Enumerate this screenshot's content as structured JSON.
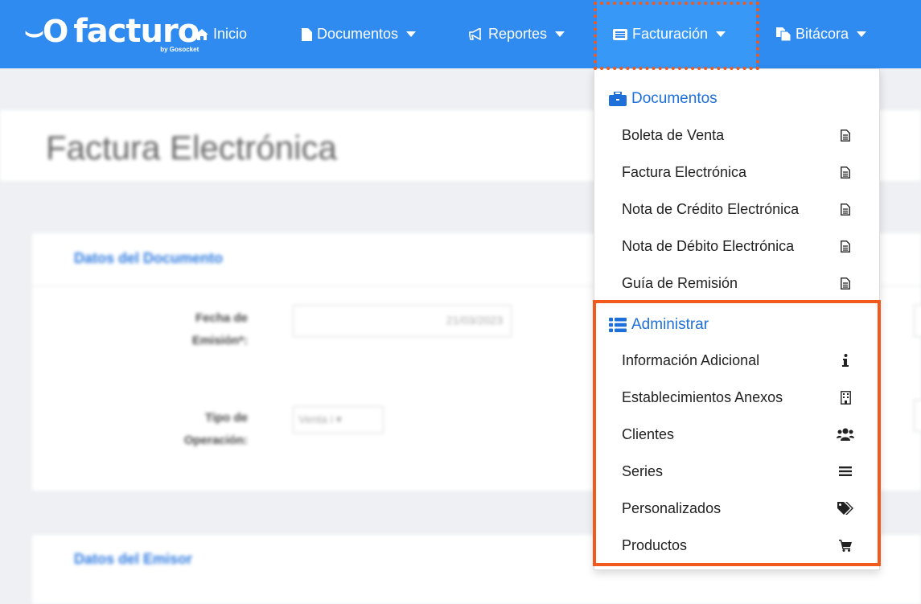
{
  "navbar": {
    "logo_text": "facturo",
    "logo_sub": "by Gosocket",
    "items": [
      {
        "label": "Inicio"
      },
      {
        "label": "Documentos"
      },
      {
        "label": "Reportes"
      },
      {
        "label": "Facturación"
      },
      {
        "label": "Bitácora"
      }
    ]
  },
  "page": {
    "title": "Factura Electrónica",
    "doc_section": {
      "title": "Datos del Documento",
      "fecha_label_1": "Fecha de",
      "fecha_label_2": "Emisión*:",
      "fecha_value": "21/03/2023",
      "tipo_label_1": "Tipo de",
      "tipo_label_2": "Operación:",
      "tipo_value": "Venta i"
    },
    "emisor_section": {
      "title": "Datos del Emisor"
    }
  },
  "dropdown": {
    "documentos_header": "Documentos",
    "documentos_items": [
      {
        "label": "Boleta de Venta",
        "icon": "file-text-icon"
      },
      {
        "label": "Factura Electrónica",
        "icon": "file-text-icon"
      },
      {
        "label": "Nota de Crédito Electrónica",
        "icon": "file-text-icon"
      },
      {
        "label": "Nota de Débito Electrónica",
        "icon": "file-text-icon"
      },
      {
        "label": "Guía de Remisión",
        "icon": "file-text-icon"
      }
    ],
    "administrar_header": "Administrar",
    "administrar_items": [
      {
        "label": "Información Adicional",
        "icon": "info-icon"
      },
      {
        "label": "Establecimientos Anexos",
        "icon": "building-icon"
      },
      {
        "label": "Clientes",
        "icon": "users-icon"
      },
      {
        "label": "Series",
        "icon": "bars-icon"
      },
      {
        "label": "Personalizados",
        "icon": "tags-icon"
      },
      {
        "label": "Productos",
        "icon": "cart-icon"
      }
    ]
  },
  "colors": {
    "navbar": "#2f8bf0",
    "highlight": "#f05a1c",
    "link": "#1e6fd9"
  }
}
